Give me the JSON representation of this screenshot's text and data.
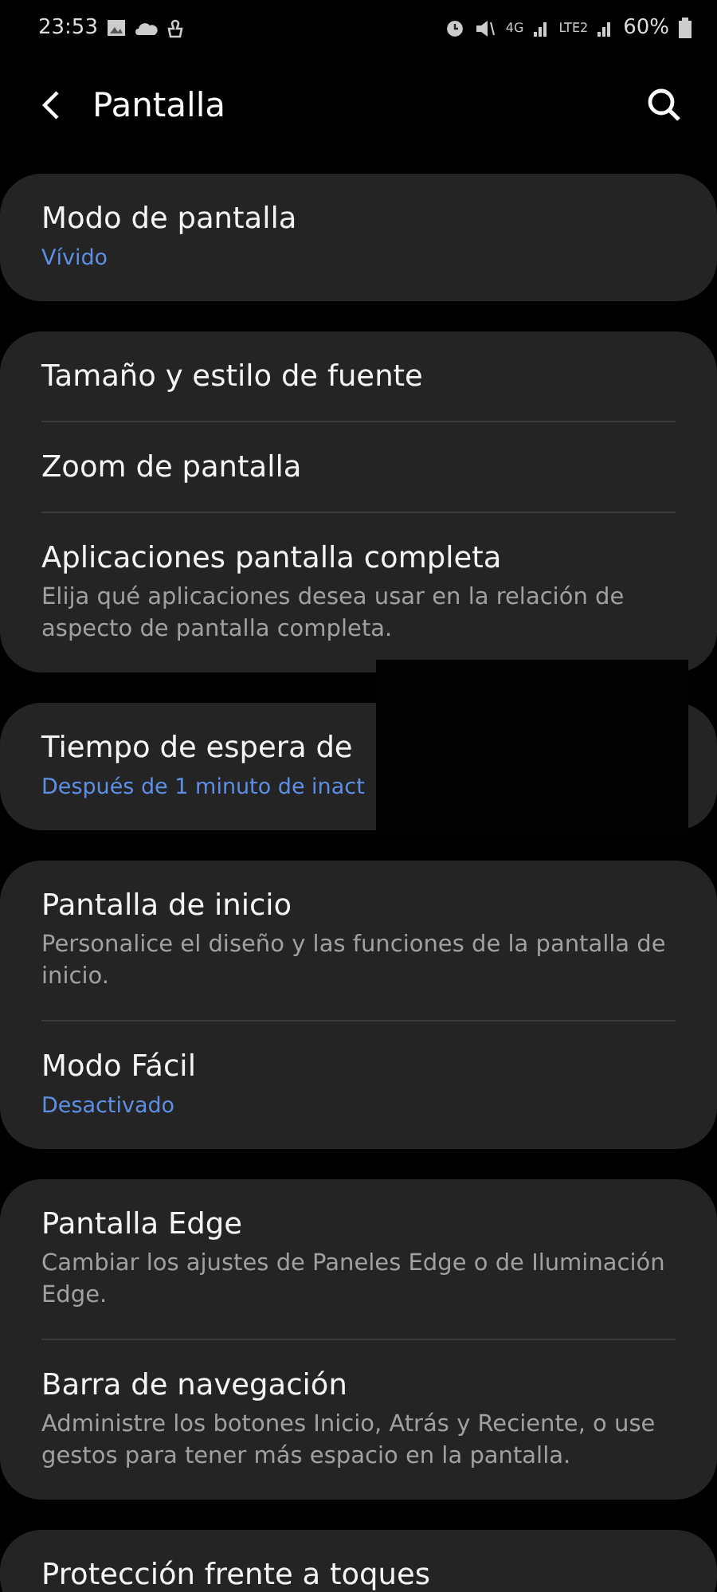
{
  "status_bar": {
    "time": "23:53",
    "network": "4G",
    "network2": "LTE2",
    "battery": "60%"
  },
  "header": {
    "title": "Pantalla"
  },
  "groups": [
    {
      "items": [
        {
          "title": "Modo de pantalla",
          "subtitle": "Vívido",
          "kind": "value"
        }
      ]
    },
    {
      "items": [
        {
          "title": "Tamaño y estilo de fuente"
        },
        {
          "title": "Zoom de pantalla"
        },
        {
          "title": "Aplicaciones pantalla completa",
          "subtitle": "Elija qué aplicaciones desea usar en la relación de aspecto de pantalla completa.",
          "kind": "description"
        }
      ]
    },
    {
      "redacted": true,
      "items": [
        {
          "title": "Tiempo de espera de",
          "subtitle": "Después de 1 minuto de inact",
          "kind": "value"
        }
      ]
    },
    {
      "items": [
        {
          "title": "Pantalla de inicio",
          "subtitle": "Personalice el diseño y las funciones de la pantalla de inicio.",
          "kind": "description"
        },
        {
          "title": "Modo Fácil",
          "subtitle": "Desactivado",
          "kind": "value"
        }
      ]
    },
    {
      "items": [
        {
          "title": "Pantalla Edge",
          "subtitle": "Cambiar los ajustes de Paneles Edge o de Iluminación Edge.",
          "kind": "description"
        },
        {
          "title": "Barra de navegación",
          "subtitle": "Administre los botones Inicio, Atrás y Reciente, o use gestos para tener más espacio en la pantalla.",
          "kind": "description"
        }
      ]
    },
    {
      "items": [
        {
          "title": "Protección frente a toques"
        }
      ]
    }
  ]
}
